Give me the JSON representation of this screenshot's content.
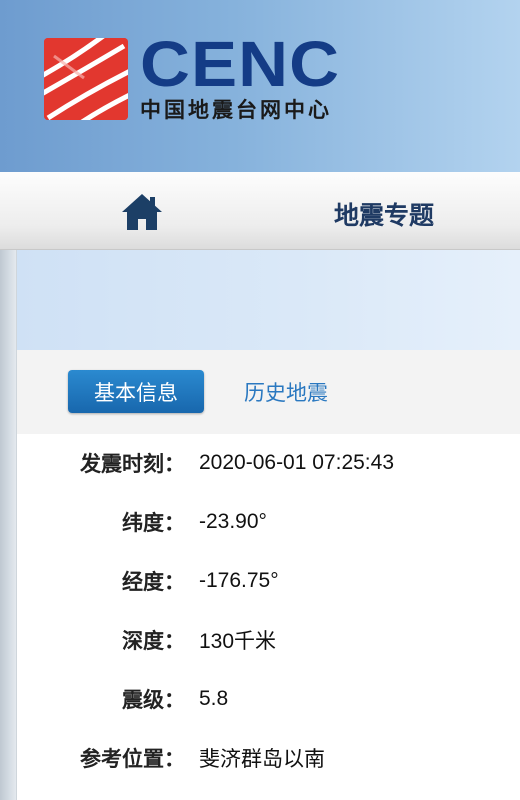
{
  "header": {
    "logo_text": "CENC",
    "logo_subtitle": "中国地震台网中心",
    "brand_red": "#e2372f",
    "brand_blue": "#143c86"
  },
  "nav": {
    "home_icon": "home-icon",
    "title": "地震专题"
  },
  "tabs": [
    {
      "label": "基本信息",
      "active": true
    },
    {
      "label": "历史地震",
      "active": false
    }
  ],
  "info": {
    "rows": [
      {
        "label": "发震时刻：",
        "value": "2020-06-01 07:25:43"
      },
      {
        "label": "纬度：",
        "value": "-23.90°"
      },
      {
        "label": "经度：",
        "value": "-176.75°"
      },
      {
        "label": "深度：",
        "value": "130千米"
      },
      {
        "label": "震级：",
        "value": "5.8"
      },
      {
        "label": "参考位置：",
        "value": "斐济群岛以南"
      }
    ]
  }
}
